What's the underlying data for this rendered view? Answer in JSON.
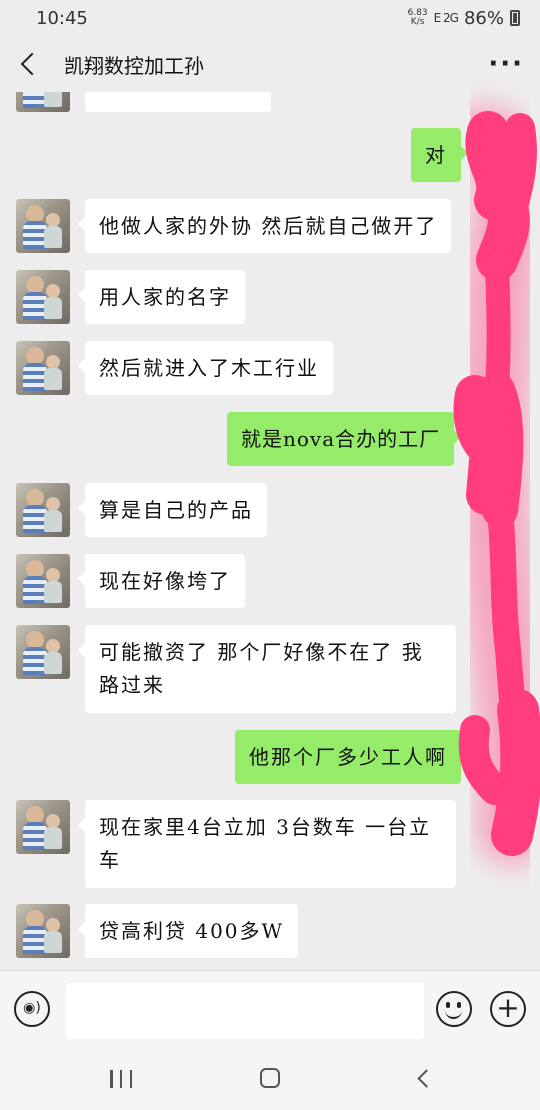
{
  "status": {
    "time": "10:45",
    "net_speed_value": "6.83",
    "net_speed_unit": "K/s",
    "signal": "E 2G",
    "battery": "86%"
  },
  "header": {
    "title": "凯翔数控加工孙"
  },
  "messages": [
    {
      "side": "left",
      "text": ""
    },
    {
      "side": "right",
      "text": "对"
    },
    {
      "side": "left",
      "text": "他做人家的外协 然后就自己做开了"
    },
    {
      "side": "left",
      "text": "用人家的名字"
    },
    {
      "side": "left",
      "text": "然后就进入了木工行业"
    },
    {
      "side": "right",
      "text": "就是nova合办的工厂"
    },
    {
      "side": "left",
      "text": "算是自己的产品"
    },
    {
      "side": "left",
      "text": "现在好像垮了"
    },
    {
      "side": "left",
      "text": "可能撤资了 那个厂好像不在了 我路过来"
    },
    {
      "side": "right",
      "text": "他那个厂多少工人啊"
    },
    {
      "side": "left",
      "text": "现在家里4台立加 3台数车 一台立车"
    },
    {
      "side": "left",
      "text": "贷高利贷 400多W"
    }
  ],
  "input": {
    "value": "",
    "placeholder": ""
  },
  "colors": {
    "background": "#ededed",
    "bubble_sent": "#95ec69",
    "bubble_received": "#ffffff",
    "scribble": "#ff3d7f"
  },
  "icons": [
    "back-icon",
    "more-icon",
    "voice-icon",
    "emoji-icon",
    "plus-icon",
    "recent-apps-icon",
    "home-icon",
    "nav-back-icon"
  ]
}
